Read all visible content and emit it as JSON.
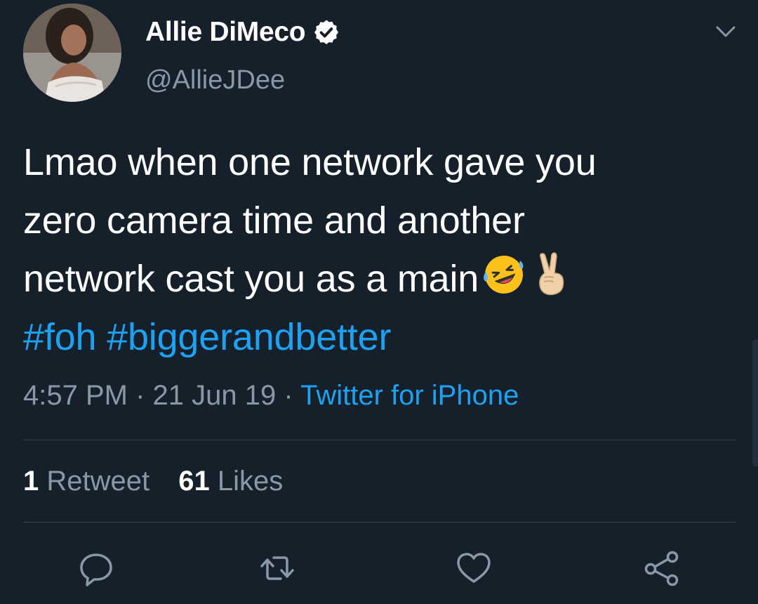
{
  "author": {
    "display_name": "Allie DiMeco",
    "handle": "@AllieJDee",
    "verified": true
  },
  "tweet": {
    "text_lines": [
      "Lmao when one network gave you",
      "zero camera time and another",
      "network cast you as a main"
    ],
    "emojis": [
      "rolling-on-floor-laughing",
      "victory-hand"
    ],
    "hashtags": [
      "#foh",
      "#biggerandbetter"
    ]
  },
  "meta": {
    "time": "4:57 PM",
    "separator": "·",
    "date": "21 Jun 19",
    "source": "Twitter for iPhone"
  },
  "stats": {
    "retweet_count": "1",
    "retweet_label": "Retweet",
    "like_count": "61",
    "like_label": "Likes"
  },
  "actions": [
    "reply-icon",
    "retweet-icon",
    "like-icon",
    "share-icon"
  ],
  "colors": {
    "background": "#15202b",
    "text": "#ffffff",
    "secondary_text": "#8899a6",
    "link": "#1da1f2",
    "divider": "#38444d"
  }
}
